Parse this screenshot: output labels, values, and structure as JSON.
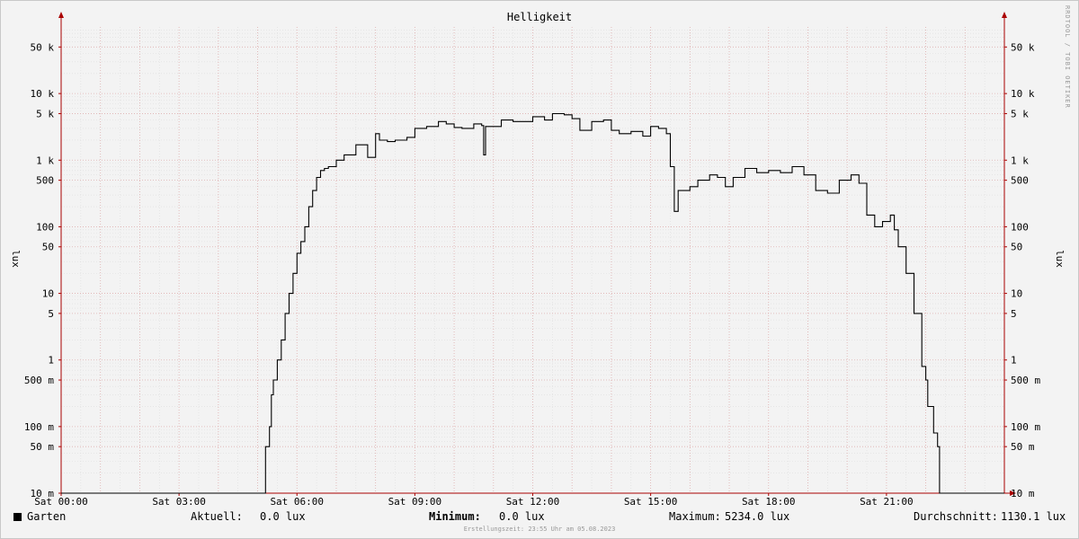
{
  "chart_data": {
    "type": "line",
    "title": "Helligkeit",
    "ylabel": "lux",
    "ylabel_right": "lux",
    "y_scale": "log",
    "ylim": [
      0.01,
      100000
    ],
    "xlim": [
      "00:00",
      "24:00"
    ],
    "x_ticks": [
      "Sat 00:00",
      "Sat 03:00",
      "Sat 06:00",
      "Sat 09:00",
      "Sat 12:00",
      "Sat 15:00",
      "Sat 18:00",
      "Sat 21:00"
    ],
    "y_ticks": [
      {
        "value": 0.01,
        "label": "10 m"
      },
      {
        "value": 0.05,
        "label": "50 m"
      },
      {
        "value": 0.1,
        "label": "100 m"
      },
      {
        "value": 0.5,
        "label": "500 m"
      },
      {
        "value": 1,
        "label": "1"
      },
      {
        "value": 5,
        "label": "5"
      },
      {
        "value": 10,
        "label": "10"
      },
      {
        "value": 50,
        "label": "50"
      },
      {
        "value": 100,
        "label": "100"
      },
      {
        "value": 500,
        "label": "500"
      },
      {
        "value": 1000,
        "label": "1 k"
      },
      {
        "value": 5000,
        "label": "5 k"
      },
      {
        "value": 10000,
        "label": "10 k"
      },
      {
        "value": 50000,
        "label": "50 k"
      }
    ],
    "grid": true,
    "grid_color": "#e0b0b0",
    "line_color": "#000000",
    "series": [
      {
        "name": "Garten",
        "x": [
          0,
          5.1,
          5.2,
          5.3,
          5.35,
          5.4,
          5.5,
          5.6,
          5.7,
          5.8,
          5.9,
          6.0,
          6.1,
          6.2,
          6.3,
          6.4,
          6.5,
          6.6,
          6.7,
          6.8,
          7.0,
          7.2,
          7.5,
          7.8,
          8.0,
          8.1,
          8.3,
          8.5,
          8.8,
          9.0,
          9.3,
          9.6,
          9.8,
          10.0,
          10.2,
          10.5,
          10.7,
          10.75,
          10.8,
          11.2,
          11.5,
          12.0,
          12.3,
          12.5,
          12.8,
          13.0,
          13.2,
          13.5,
          13.8,
          14.0,
          14.2,
          14.5,
          14.8,
          15.0,
          15.2,
          15.4,
          15.5,
          15.6,
          15.7,
          16.0,
          16.2,
          16.5,
          16.7,
          16.9,
          17.1,
          17.4,
          17.7,
          18.0,
          18.3,
          18.6,
          18.9,
          19.2,
          19.5,
          19.8,
          20.1,
          20.3,
          20.5,
          20.7,
          20.9,
          21.1,
          21.2,
          21.3,
          21.5,
          21.7,
          21.9,
          22.0,
          22.05,
          22.2,
          22.3,
          22.35,
          24.0
        ],
        "y": [
          0.01,
          0.01,
          0.05,
          0.1,
          0.3,
          0.5,
          1,
          2,
          5,
          10,
          20,
          40,
          60,
          100,
          200,
          350,
          550,
          700,
          750,
          800,
          1000,
          1200,
          1700,
          1100,
          2500,
          2000,
          1900,
          2000,
          2200,
          3000,
          3200,
          3800,
          3500,
          3100,
          3000,
          3500,
          3300,
          1200,
          3200,
          4000,
          3800,
          4500,
          4000,
          5000,
          4800,
          4200,
          2800,
          3800,
          4000,
          2800,
          2500,
          2700,
          2300,
          3200,
          3000,
          2500,
          800,
          170,
          350,
          400,
          500,
          600,
          550,
          400,
          550,
          750,
          650,
          700,
          650,
          800,
          600,
          350,
          320,
          500,
          600,
          450,
          150,
          100,
          120,
          150,
          90,
          50,
          20,
          5,
          0.8,
          0.5,
          0.2,
          0.08,
          0.05,
          0.01,
          0.01
        ]
      }
    ]
  },
  "legend": {
    "series_name": "Garten",
    "current_label": "Aktuell:",
    "current_value": "0.0 lux",
    "min_label": "Minimum:",
    "min_value": "0.0 lux",
    "max_label": "Maximum:",
    "max_value": "5234.0 lux",
    "avg_label": "Durchschnitt:",
    "avg_value": "1130.1 lux"
  },
  "footer": "Erstellungszeit: 23:55 Uhr am 05.08.2023",
  "watermark": "RRDTOOL / TOBI OETIKER"
}
